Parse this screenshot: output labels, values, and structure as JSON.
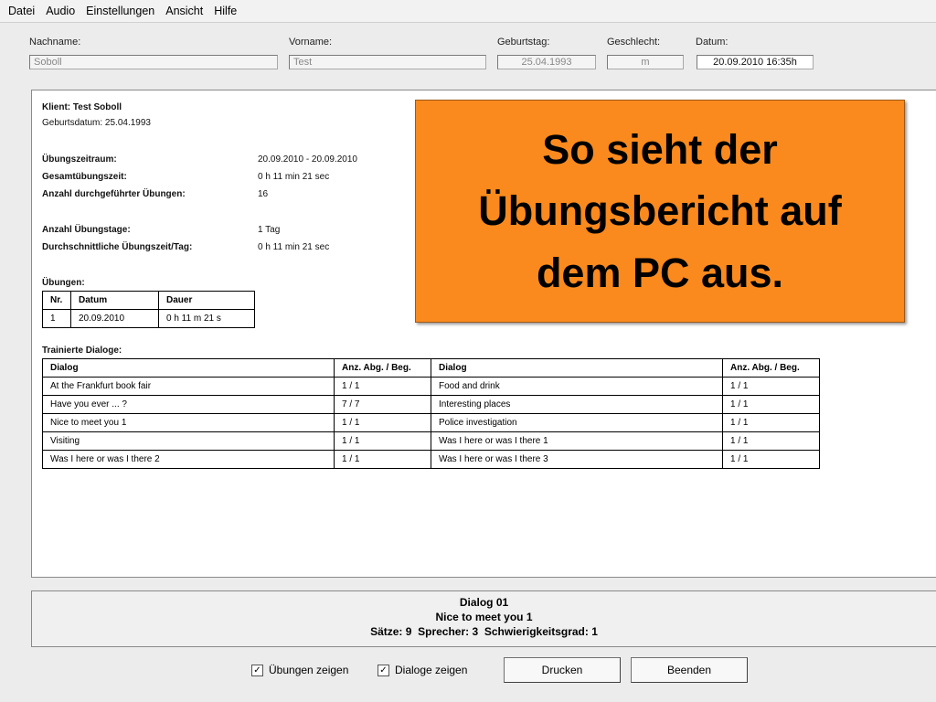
{
  "menu": [
    "Datei",
    "Audio",
    "Einstellungen",
    "Ansicht",
    "Hilfe"
  ],
  "fields": {
    "nachname_label": "Nachname:",
    "nachname_value": "Soboll",
    "vorname_label": "Vorname:",
    "vorname_value": "Test",
    "geburtstag_label": "Geburtstag:",
    "geburtstag_value": "25.04.1993",
    "geschlecht_label": "Geschlecht:",
    "geschlecht_value": "m",
    "datum_label": "Datum:",
    "datum_value": "20.09.2010 16:35h"
  },
  "report": {
    "klient": "Klient: Test Soboll",
    "geburtsdatum": "Geburtsdatum: 25.04.1993",
    "stats": [
      {
        "label": "Übungszeitraum:",
        "value": "20.09.2010 - 20.09.2010"
      },
      {
        "label": "Gesamtübungszeit:",
        "value": "0 h 11 min 21 sec"
      },
      {
        "label": "Anzahl durchgeführter Übungen:",
        "value": "16"
      },
      {
        "label": "Anzahl Übungstage:",
        "value": "1 Tag"
      },
      {
        "label": "Durchschnittliche Übungszeit/Tag:",
        "value": "0 h 11 min 21 sec"
      }
    ],
    "uebungen_title": "Übungen:",
    "uebungen_headers": [
      "Nr.",
      "Datum",
      "Dauer"
    ],
    "uebungen_rows": [
      [
        "1",
        "20.09.2010",
        "0 h 11 m 21 s"
      ]
    ],
    "dialoge_title": "Trainierte Dialoge:",
    "dialoge_headers": [
      "Dialog",
      "Anz. Abg. / Beg.",
      "Dialog",
      "Anz. Abg. / Beg."
    ],
    "dialoge_rows": [
      [
        "At the Frankfurt book fair",
        "1 / 1",
        "Food and drink",
        "1 / 1"
      ],
      [
        "Have you ever ... ?",
        "7 / 7",
        "Interesting places",
        "1 / 1"
      ],
      [
        "Nice to meet you 1",
        "1 / 1",
        "Police investigation",
        "1 / 1"
      ],
      [
        "Visiting",
        "1 / 1",
        "Was I here or was I there 1",
        "1 / 1"
      ],
      [
        "Was I here or was I there 2",
        "1 / 1",
        "Was I here or was I there 3",
        "1 / 1"
      ]
    ]
  },
  "overlay": {
    "line1": "So sieht der",
    "line2": "Übungsbericht auf",
    "line3": "dem PC aus."
  },
  "status": {
    "dialog": "Dialog 01",
    "title": "Nice to meet you 1",
    "saetze_label": "Sätze:",
    "saetze_value": "9",
    "sprecher_label": "Sprecher:",
    "sprecher_value": "3",
    "schwierig_label": "Schwierigkeitsgrad:",
    "schwierig_value": "1"
  },
  "controls": {
    "uebungen_zeigen": "Übungen zeigen",
    "dialoge_zeigen": "Dialoge zeigen",
    "drucken": "Drucken",
    "beenden": "Beenden",
    "check_mark": "✓"
  }
}
